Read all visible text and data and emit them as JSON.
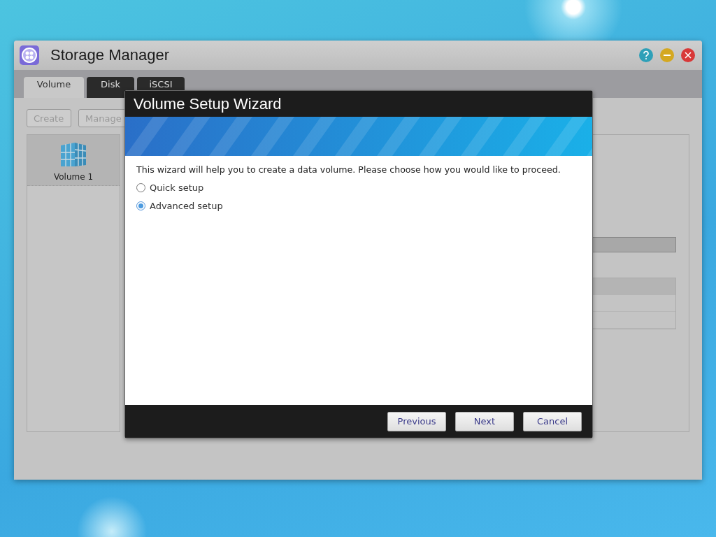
{
  "window": {
    "title": "Storage Manager"
  },
  "tabs": [
    {
      "label": "Volume",
      "selected": true
    },
    {
      "label": "Disk",
      "selected": false
    },
    {
      "label": "iSCSI",
      "selected": false
    }
  ],
  "toolbar": {
    "buttons": [
      {
        "label": "Create",
        "disabled": true
      },
      {
        "label": "Manage",
        "disabled": true
      }
    ]
  },
  "volumes": [
    {
      "label": "Volume 1",
      "selected": true
    }
  ],
  "dialog": {
    "title": "Volume Setup Wizard",
    "message": "This wizard will help you to create a data volume. Please choose how you would like to proceed.",
    "options": [
      {
        "label": "Quick setup",
        "selected": false
      },
      {
        "label": "Advanced setup",
        "selected": true
      }
    ],
    "buttons": [
      "Previous",
      "Next",
      "Cancel"
    ]
  }
}
